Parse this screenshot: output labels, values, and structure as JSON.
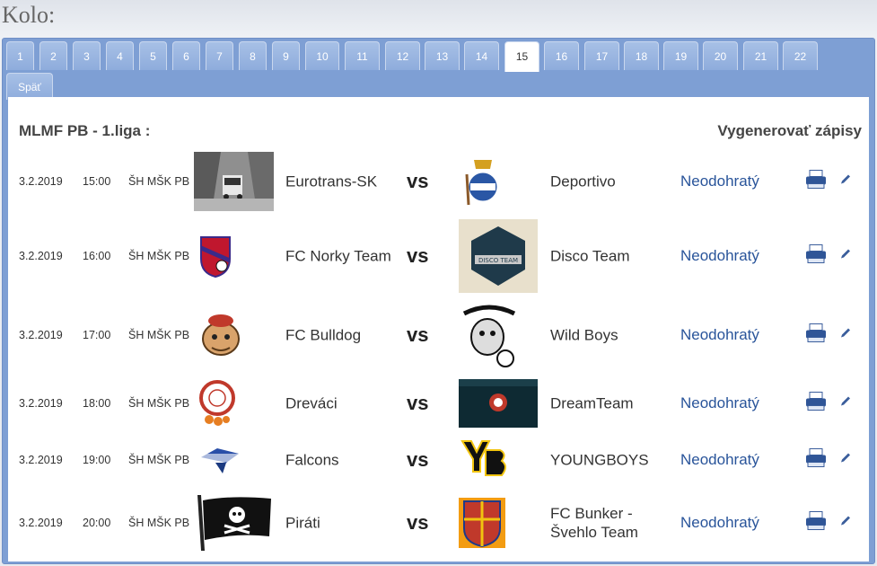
{
  "header": {
    "title": "Kolo:"
  },
  "tabs": [
    "1",
    "2",
    "3",
    "4",
    "5",
    "6",
    "7",
    "8",
    "9",
    "10",
    "11",
    "12",
    "13",
    "14",
    "15",
    "16",
    "17",
    "18",
    "19",
    "20",
    "21",
    "22"
  ],
  "active_tab": "15",
  "back_label": "Späť",
  "league": {
    "title": "MLMF PB - 1.liga :",
    "generate_label": "Vygenerovať zápisy"
  },
  "colors": {
    "accent": "#7e9fd4",
    "status": "#29549a",
    "tab": "#99b5e0"
  },
  "matches": [
    {
      "date": "3.2.2019",
      "time": "15:00",
      "venue": "ŠH MŠK PB",
      "home": "Eurotrans-SK",
      "home_logo": "truck-photo",
      "vs": "vs",
      "away": "Deportivo",
      "away_logo": "crown-crest",
      "status": "Neodohratý"
    },
    {
      "date": "3.2.2019",
      "time": "16:00",
      "venue": "ŠH MŠK PB",
      "home": "FC Norky Team",
      "home_logo": "red-shield-crest",
      "vs": "vs",
      "away": "Disco Team",
      "away_logo": "disco-team-badge",
      "status": "Neodohratý"
    },
    {
      "date": "3.2.2019",
      "time": "17:00",
      "venue": "ŠH MŠK PB",
      "home": "FC Bulldog",
      "home_logo": "bulldog-mascot",
      "vs": "vs",
      "away": "Wild Boys",
      "away_logo": "wildboys-logo",
      "status": "Neodohratý"
    },
    {
      "date": "3.2.2019",
      "time": "18:00",
      "venue": "ŠH MŠK PB",
      "home": "Dreváci",
      "home_logo": "round-crest",
      "vs": "vs",
      "away": "DreamTeam",
      "away_logo": "dreamteam-banner",
      "status": "Neodohratý"
    },
    {
      "date": "3.2.2019",
      "time": "19:00",
      "venue": "ŠH MŠK PB",
      "home": "Falcons",
      "home_logo": "falcons-logo",
      "vs": "vs",
      "away": "YOUNGBOYS",
      "away_logo": "yb-logo",
      "status": "Neodohratý"
    },
    {
      "date": "3.2.2019",
      "time": "20:00",
      "venue": "ŠH MŠK PB",
      "home": "Piráti",
      "home_logo": "pirate-flag",
      "vs": "vs",
      "away": "FC Bunker - Švehlo Team",
      "away_logo": "bunker-shield",
      "status": "Neodohratý"
    }
  ]
}
